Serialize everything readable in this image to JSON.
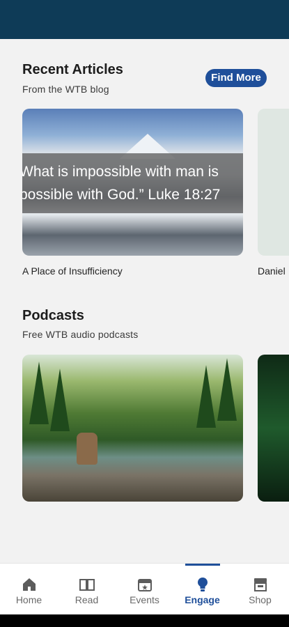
{
  "recent_articles": {
    "title": "Recent Articles",
    "subtitle": "From the WTB blog",
    "find_more_label": "Find More",
    "cards": [
      {
        "quote_line1": "What is impossible with man is",
        "quote_line2": "possible with God.” Luke 18:27",
        "caption": "A Place of Insufficiency"
      },
      {
        "caption": "Daniel"
      }
    ]
  },
  "podcasts": {
    "title": "Podcasts",
    "subtitle": "Free WTB audio podcasts"
  },
  "bottom_nav": {
    "active": "Engage",
    "items": [
      {
        "label": "Home",
        "icon": "home-icon"
      },
      {
        "label": "Read",
        "icon": "book-icon"
      },
      {
        "label": "Events",
        "icon": "calendar-icon"
      },
      {
        "label": "Engage",
        "icon": "lightbulb-icon"
      },
      {
        "label": "Shop",
        "icon": "store-icon"
      }
    ]
  },
  "colors": {
    "top_bar": "#0e3b57",
    "accent": "#1f4f9a",
    "background": "#f2f2f2"
  }
}
